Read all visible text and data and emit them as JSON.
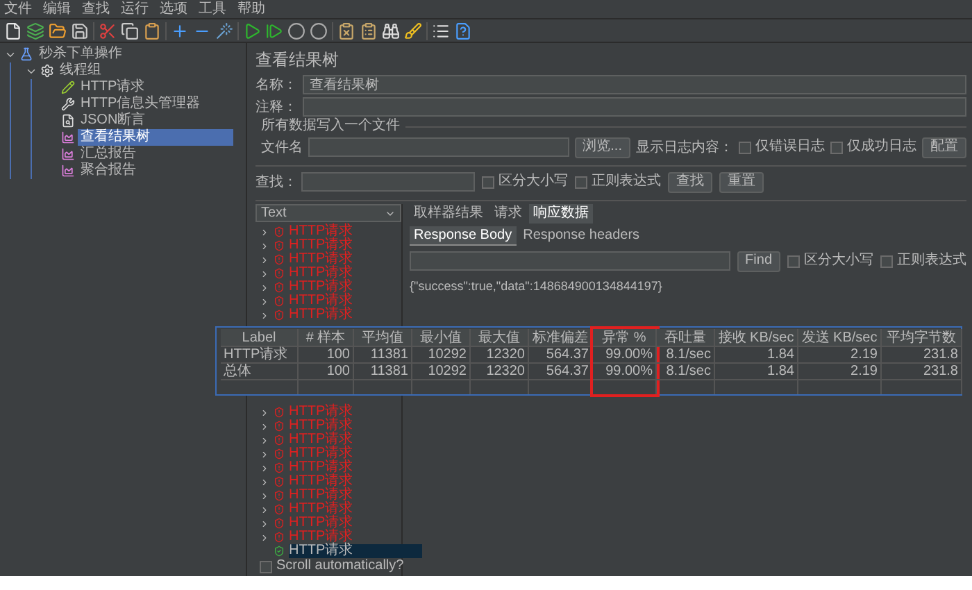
{
  "menu": [
    "文件",
    "编辑",
    "查找",
    "运行",
    "选项",
    "工具",
    "帮助"
  ],
  "tree": [
    {
      "label": "秒杀下单操作",
      "kind": "plan",
      "expanded": true,
      "selected": false,
      "children": [
        {
          "label": "线程组",
          "kind": "threads",
          "expanded": true,
          "selected": false,
          "children": [
            {
              "label": "HTTP请求",
              "kind": "sampler",
              "selected": false
            },
            {
              "label": "HTTP信息头管理器",
              "kind": "config",
              "selected": false
            },
            {
              "label": "JSON断言",
              "kind": "assertion",
              "selected": false
            },
            {
              "label": "查看结果树",
              "kind": "listener",
              "selected": true
            },
            {
              "label": "汇总报告",
              "kind": "listener",
              "selected": false
            },
            {
              "label": "聚合报告",
              "kind": "listener",
              "selected": false
            }
          ]
        }
      ]
    }
  ],
  "panel": {
    "title": "查看结果树",
    "name_label": "名称：",
    "name_value": "查看结果树",
    "comment_label": "注释：",
    "file_section": "所有数据写入一个文件",
    "file_label": "文件名",
    "browse": "浏览...",
    "log_label": "显示日志内容：",
    "error_only": {
      "label": "仅错误日志",
      "checked": false
    },
    "success_only": {
      "label": "仅成功日志",
      "checked": false
    },
    "config": "配置",
    "search_label": "查找：",
    "case": {
      "label": "区分大小写",
      "checked": false
    },
    "regex": {
      "label": "正则表达式",
      "checked": false
    },
    "find": "查找",
    "reset": "重置"
  },
  "results": {
    "renderer": "Text",
    "samples_upper": [
      {
        "label": "HTTP请求",
        "success": false,
        "selected": false
      },
      {
        "label": "HTTP请求",
        "success": false,
        "selected": false
      },
      {
        "label": "HTTP请求",
        "success": false,
        "selected": false
      },
      {
        "label": "HTTP请求",
        "success": false,
        "selected": false
      },
      {
        "label": "HTTP请求",
        "success": false,
        "selected": false
      },
      {
        "label": "HTTP请求",
        "success": false,
        "selected": false
      },
      {
        "label": "HTTP请求",
        "success": false,
        "selected": false
      }
    ],
    "samples_lower": [
      {
        "label": "HTTP请求",
        "success": false,
        "selected": false
      },
      {
        "label": "HTTP请求",
        "success": false,
        "selected": false
      },
      {
        "label": "HTTP请求",
        "success": false,
        "selected": false
      },
      {
        "label": "HTTP请求",
        "success": false,
        "selected": false
      },
      {
        "label": "HTTP请求",
        "success": false,
        "selected": false
      },
      {
        "label": "HTTP请求",
        "success": false,
        "selected": false
      },
      {
        "label": "HTTP请求",
        "success": false,
        "selected": false
      },
      {
        "label": "HTTP请求",
        "success": false,
        "selected": false
      },
      {
        "label": "HTTP请求",
        "success": false,
        "selected": false
      },
      {
        "label": "HTTP请求",
        "success": false,
        "selected": false
      },
      {
        "label": "HTTP请求",
        "success": true,
        "selected": true
      }
    ],
    "scroll_auto": {
      "label": "Scroll automatically?",
      "checked": false
    },
    "tabs": [
      {
        "label": "取样器结果",
        "selected": false
      },
      {
        "label": "请求",
        "selected": false
      },
      {
        "label": "响应数据",
        "selected": true
      }
    ],
    "subtabs": [
      {
        "label": "Response Body",
        "selected": true
      },
      {
        "label": "Response headers",
        "selected": false
      }
    ],
    "find_button": "Find",
    "case": {
      "label": "区分大小写",
      "checked": false
    },
    "regex": {
      "label": "正则表达式",
      "checked": false
    },
    "body": "{\"success\":true,\"data\":148684900134844197}"
  },
  "summary_table": {
    "columns": [
      {
        "label": "Label",
        "highlighted": false
      },
      {
        "label": "# 样本",
        "highlighted": false
      },
      {
        "label": "平均值",
        "highlighted": false
      },
      {
        "label": "最小值",
        "highlighted": false
      },
      {
        "label": "最大值",
        "highlighted": false
      },
      {
        "label": "标准偏差",
        "highlighted": false
      },
      {
        "label": "异常 %",
        "highlighted": true
      },
      {
        "label": "吞吐量",
        "highlighted": false
      },
      {
        "label": "接收 KB/sec",
        "highlighted": false
      },
      {
        "label": "发送 KB/sec",
        "highlighted": false
      },
      {
        "label": "平均字节数",
        "highlighted": false
      }
    ],
    "rows": [
      [
        "HTTP请求",
        "100",
        "11381",
        "10292",
        "12320",
        "564.37",
        "99.00%",
        "8.1/sec",
        "1.84",
        "2.19",
        "231.8"
      ],
      [
        "总体",
        "100",
        "11381",
        "10292",
        "12320",
        "564.37",
        "99.00%",
        "8.1/sec",
        "1.84",
        "2.19",
        "231.8"
      ]
    ]
  }
}
